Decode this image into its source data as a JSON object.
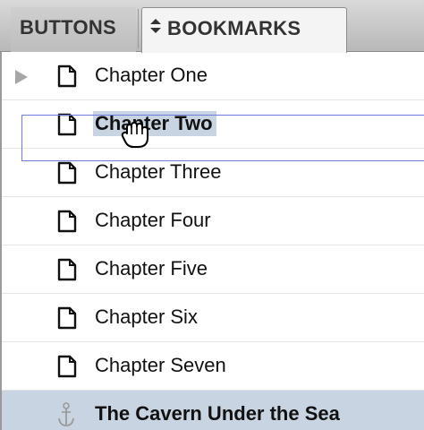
{
  "tabs": {
    "buttons": "BUTTONS",
    "bookmarks": "BOOKMARKS"
  },
  "bookmarks": [
    {
      "label": "Chapter One",
      "icon": "page-icon",
      "expandable": true
    },
    {
      "label": "Chapter Two",
      "icon": "page-icon",
      "dragging": true
    },
    {
      "label": "Chapter Three",
      "icon": "page-icon"
    },
    {
      "label": "Chapter Four",
      "icon": "page-icon"
    },
    {
      "label": "Chapter Five",
      "icon": "page-icon"
    },
    {
      "label": "Chapter Six",
      "icon": "page-icon"
    },
    {
      "label": "Chapter Seven",
      "icon": "page-icon"
    },
    {
      "label": "The Cavern Under the Sea",
      "icon": "anchor-icon",
      "selected": true
    }
  ],
  "colors": {
    "selection": "#c9d4e2",
    "drop_indicator": "#6f7bdf"
  }
}
